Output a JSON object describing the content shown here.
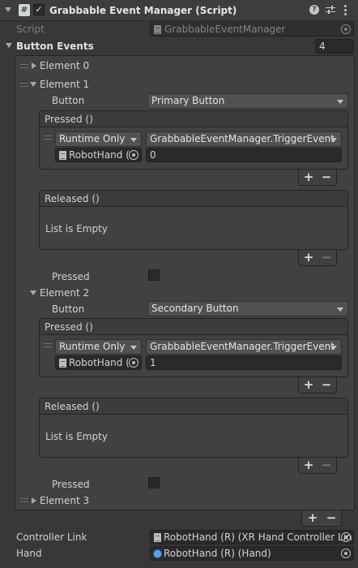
{
  "header": {
    "title": "Grabbable Event Manager (Script)",
    "enabled": true
  },
  "script_field": {
    "label": "Script",
    "value": "GrabbableEventManager"
  },
  "button_events": {
    "label": "Button Events",
    "count": "4",
    "elements": [
      {
        "label": "Element 0",
        "expanded": false
      },
      {
        "label": "Element 1",
        "expanded": true,
        "button_label": "Button",
        "button_value": "Primary Button",
        "pressed_event": {
          "title": "Pressed ()",
          "mode": "Runtime Only",
          "function": "GrabbableEventManager.TriggerEvent",
          "target": "RobotHand (",
          "argument": "0"
        },
        "released_event": {
          "title": "Released ()",
          "empty_text": "List is Empty"
        },
        "pressed_label": "Pressed"
      },
      {
        "label": "Element 2",
        "expanded": true,
        "button_label": "Button",
        "button_value": "Secondary Button",
        "pressed_event": {
          "title": "Pressed ()",
          "mode": "Runtime Only",
          "function": "GrabbableEventManager.TriggerEvent",
          "target": "RobotHand (",
          "argument": "1"
        },
        "released_event": {
          "title": "Released ()",
          "empty_text": "List is Empty"
        },
        "pressed_label": "Pressed"
      },
      {
        "label": "Element 3",
        "expanded": false
      }
    ]
  },
  "controller_link": {
    "label": "Controller Link",
    "value": "RobotHand (R) (XR Hand Controller Lin"
  },
  "hand": {
    "label": "Hand",
    "value": "RobotHand (R) (Hand)"
  },
  "icons": {
    "collapse": "chevron-down-icon",
    "script": "script-file-icon",
    "help": "help-icon",
    "presets": "presets-icon",
    "more": "kebab-menu-icon",
    "target": "object-picker-icon",
    "drag": "drag-handle-icon",
    "add": "plus-icon",
    "remove": "minus-icon"
  },
  "colors": {
    "background": "#383838",
    "field": "#2a2a2a",
    "dropdown": "#515151",
    "panel": "#414141"
  }
}
